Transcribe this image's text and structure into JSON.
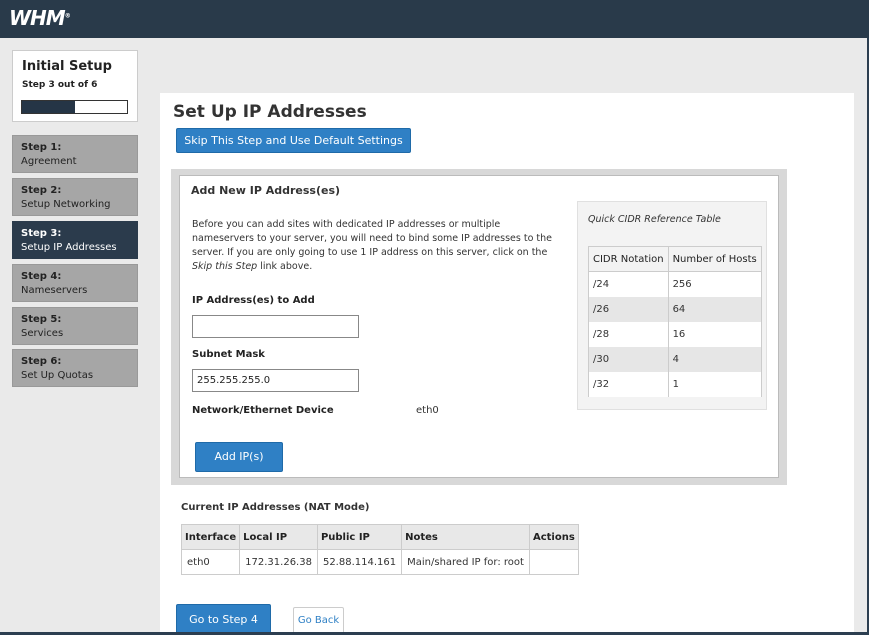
{
  "header": {
    "logo_text": "WHM",
    "trademark": "®"
  },
  "progress": {
    "title": "Initial Setup",
    "subtitle": "Step 3 out of 6",
    "fraction": 0.5
  },
  "steps": [
    {
      "num": "Step 1:",
      "name": "Agreement",
      "active": false
    },
    {
      "num": "Step 2:",
      "name": "Setup Networking",
      "active": false
    },
    {
      "num": "Step 3:",
      "name": "Setup IP Addresses",
      "active": true
    },
    {
      "num": "Step 4:",
      "name": "Nameservers",
      "active": false
    },
    {
      "num": "Step 5:",
      "name": "Services",
      "active": false
    },
    {
      "num": "Step 6:",
      "name": "Set Up Quotas",
      "active": false
    }
  ],
  "main": {
    "title": "Set Up IP Addresses",
    "skip_label": "Skip This Step and Use Default Settings",
    "add_section": {
      "heading": "Add New IP Address(es)",
      "description_before": "Before you can add sites with dedicated IP addresses or multiple nameservers to your server, you will need to bind some IP addresses to the server. If you are only going to use 1 IP address on this server, click on the ",
      "description_link": "Skip this Step",
      "description_after": " link above.",
      "ip_label": "IP Address(es) to Add",
      "ip_value": "",
      "subnet_label": "Subnet Mask",
      "subnet_value": "255.255.255.0",
      "device_label": "Network/Ethernet Device",
      "device_value": "eth0",
      "add_label": "Add IP(s)"
    },
    "cidr": {
      "title": "Quick CIDR Reference Table",
      "headers": [
        "CIDR Notation",
        "Number of Hosts"
      ],
      "rows": [
        [
          "/24",
          "256"
        ],
        [
          "/26",
          "64"
        ],
        [
          "/28",
          "16"
        ],
        [
          "/30",
          "4"
        ],
        [
          "/32",
          "1"
        ]
      ]
    },
    "current": {
      "heading": "Current IP Addresses (NAT Mode)",
      "headers": [
        "Interface",
        "Local IP",
        "Public IP",
        "Notes",
        "Actions"
      ],
      "rows": [
        [
          "eth0",
          "172.31.26.38",
          "52.88.114.161",
          "Main/shared IP for: root",
          ""
        ]
      ]
    },
    "next_label": "Go to Step 4",
    "back_label": "Go Back"
  },
  "colors": {
    "header_bg": "#293a4a",
    "accent": "#2f80c5",
    "active_step": "#2b3b4c"
  }
}
